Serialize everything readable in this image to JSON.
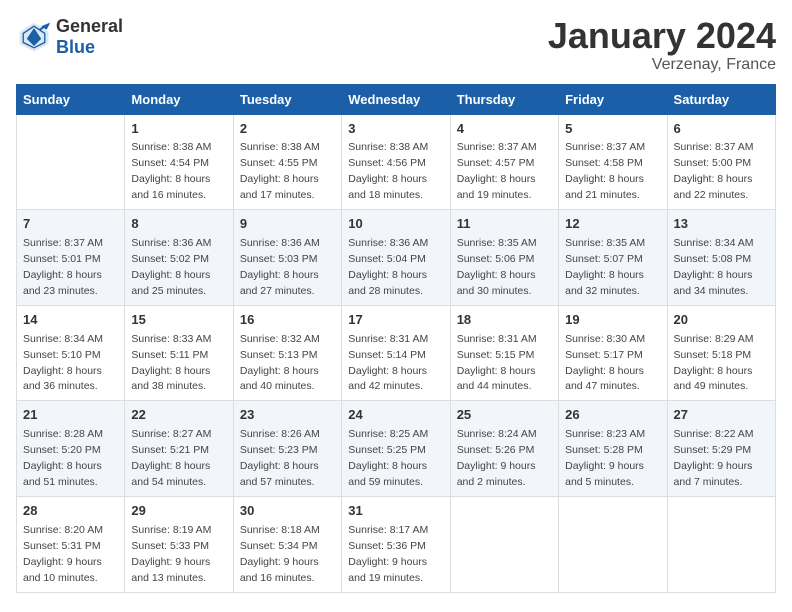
{
  "logo": {
    "general": "General",
    "blue": "Blue"
  },
  "title": "January 2024",
  "location": "Verzenay, France",
  "days_header": [
    "Sunday",
    "Monday",
    "Tuesday",
    "Wednesday",
    "Thursday",
    "Friday",
    "Saturday"
  ],
  "weeks": [
    [
      {
        "day": "",
        "sunrise": "",
        "sunset": "",
        "daylight": ""
      },
      {
        "day": "1",
        "sunrise": "Sunrise: 8:38 AM",
        "sunset": "Sunset: 4:54 PM",
        "daylight": "Daylight: 8 hours and 16 minutes."
      },
      {
        "day": "2",
        "sunrise": "Sunrise: 8:38 AM",
        "sunset": "Sunset: 4:55 PM",
        "daylight": "Daylight: 8 hours and 17 minutes."
      },
      {
        "day": "3",
        "sunrise": "Sunrise: 8:38 AM",
        "sunset": "Sunset: 4:56 PM",
        "daylight": "Daylight: 8 hours and 18 minutes."
      },
      {
        "day": "4",
        "sunrise": "Sunrise: 8:37 AM",
        "sunset": "Sunset: 4:57 PM",
        "daylight": "Daylight: 8 hours and 19 minutes."
      },
      {
        "day": "5",
        "sunrise": "Sunrise: 8:37 AM",
        "sunset": "Sunset: 4:58 PM",
        "daylight": "Daylight: 8 hours and 21 minutes."
      },
      {
        "day": "6",
        "sunrise": "Sunrise: 8:37 AM",
        "sunset": "Sunset: 5:00 PM",
        "daylight": "Daylight: 8 hours and 22 minutes."
      }
    ],
    [
      {
        "day": "7",
        "sunrise": "Sunrise: 8:37 AM",
        "sunset": "Sunset: 5:01 PM",
        "daylight": "Daylight: 8 hours and 23 minutes."
      },
      {
        "day": "8",
        "sunrise": "Sunrise: 8:36 AM",
        "sunset": "Sunset: 5:02 PM",
        "daylight": "Daylight: 8 hours and 25 minutes."
      },
      {
        "day": "9",
        "sunrise": "Sunrise: 8:36 AM",
        "sunset": "Sunset: 5:03 PM",
        "daylight": "Daylight: 8 hours and 27 minutes."
      },
      {
        "day": "10",
        "sunrise": "Sunrise: 8:36 AM",
        "sunset": "Sunset: 5:04 PM",
        "daylight": "Daylight: 8 hours and 28 minutes."
      },
      {
        "day": "11",
        "sunrise": "Sunrise: 8:35 AM",
        "sunset": "Sunset: 5:06 PM",
        "daylight": "Daylight: 8 hours and 30 minutes."
      },
      {
        "day": "12",
        "sunrise": "Sunrise: 8:35 AM",
        "sunset": "Sunset: 5:07 PM",
        "daylight": "Daylight: 8 hours and 32 minutes."
      },
      {
        "day": "13",
        "sunrise": "Sunrise: 8:34 AM",
        "sunset": "Sunset: 5:08 PM",
        "daylight": "Daylight: 8 hours and 34 minutes."
      }
    ],
    [
      {
        "day": "14",
        "sunrise": "Sunrise: 8:34 AM",
        "sunset": "Sunset: 5:10 PM",
        "daylight": "Daylight: 8 hours and 36 minutes."
      },
      {
        "day": "15",
        "sunrise": "Sunrise: 8:33 AM",
        "sunset": "Sunset: 5:11 PM",
        "daylight": "Daylight: 8 hours and 38 minutes."
      },
      {
        "day": "16",
        "sunrise": "Sunrise: 8:32 AM",
        "sunset": "Sunset: 5:13 PM",
        "daylight": "Daylight: 8 hours and 40 minutes."
      },
      {
        "day": "17",
        "sunrise": "Sunrise: 8:31 AM",
        "sunset": "Sunset: 5:14 PM",
        "daylight": "Daylight: 8 hours and 42 minutes."
      },
      {
        "day": "18",
        "sunrise": "Sunrise: 8:31 AM",
        "sunset": "Sunset: 5:15 PM",
        "daylight": "Daylight: 8 hours and 44 minutes."
      },
      {
        "day": "19",
        "sunrise": "Sunrise: 8:30 AM",
        "sunset": "Sunset: 5:17 PM",
        "daylight": "Daylight: 8 hours and 47 minutes."
      },
      {
        "day": "20",
        "sunrise": "Sunrise: 8:29 AM",
        "sunset": "Sunset: 5:18 PM",
        "daylight": "Daylight: 8 hours and 49 minutes."
      }
    ],
    [
      {
        "day": "21",
        "sunrise": "Sunrise: 8:28 AM",
        "sunset": "Sunset: 5:20 PM",
        "daylight": "Daylight: 8 hours and 51 minutes."
      },
      {
        "day": "22",
        "sunrise": "Sunrise: 8:27 AM",
        "sunset": "Sunset: 5:21 PM",
        "daylight": "Daylight: 8 hours and 54 minutes."
      },
      {
        "day": "23",
        "sunrise": "Sunrise: 8:26 AM",
        "sunset": "Sunset: 5:23 PM",
        "daylight": "Daylight: 8 hours and 57 minutes."
      },
      {
        "day": "24",
        "sunrise": "Sunrise: 8:25 AM",
        "sunset": "Sunset: 5:25 PM",
        "daylight": "Daylight: 8 hours and 59 minutes."
      },
      {
        "day": "25",
        "sunrise": "Sunrise: 8:24 AM",
        "sunset": "Sunset: 5:26 PM",
        "daylight": "Daylight: 9 hours and 2 minutes."
      },
      {
        "day": "26",
        "sunrise": "Sunrise: 8:23 AM",
        "sunset": "Sunset: 5:28 PM",
        "daylight": "Daylight: 9 hours and 5 minutes."
      },
      {
        "day": "27",
        "sunrise": "Sunrise: 8:22 AM",
        "sunset": "Sunset: 5:29 PM",
        "daylight": "Daylight: 9 hours and 7 minutes."
      }
    ],
    [
      {
        "day": "28",
        "sunrise": "Sunrise: 8:20 AM",
        "sunset": "Sunset: 5:31 PM",
        "daylight": "Daylight: 9 hours and 10 minutes."
      },
      {
        "day": "29",
        "sunrise": "Sunrise: 8:19 AM",
        "sunset": "Sunset: 5:33 PM",
        "daylight": "Daylight: 9 hours and 13 minutes."
      },
      {
        "day": "30",
        "sunrise": "Sunrise: 8:18 AM",
        "sunset": "Sunset: 5:34 PM",
        "daylight": "Daylight: 9 hours and 16 minutes."
      },
      {
        "day": "31",
        "sunrise": "Sunrise: 8:17 AM",
        "sunset": "Sunset: 5:36 PM",
        "daylight": "Daylight: 9 hours and 19 minutes."
      },
      {
        "day": "",
        "sunrise": "",
        "sunset": "",
        "daylight": ""
      },
      {
        "day": "",
        "sunrise": "",
        "sunset": "",
        "daylight": ""
      },
      {
        "day": "",
        "sunrise": "",
        "sunset": "",
        "daylight": ""
      }
    ]
  ]
}
